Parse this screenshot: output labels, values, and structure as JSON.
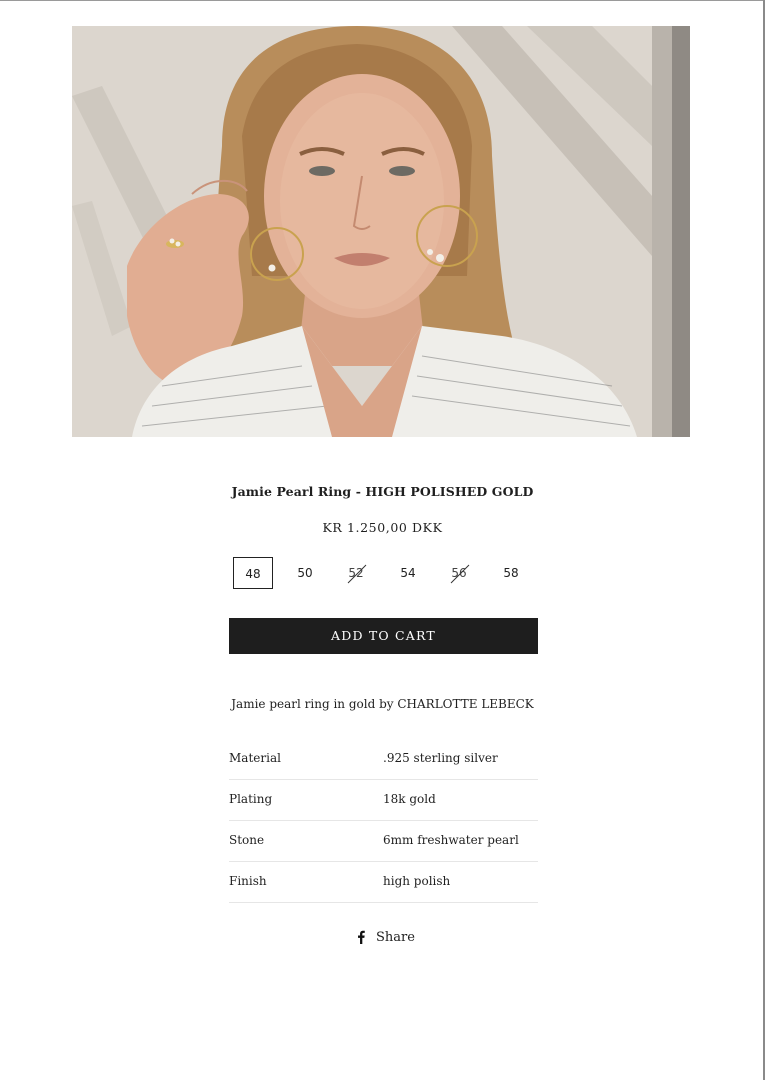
{
  "product": {
    "image_alt": "Model wearing Jamie pearl ring and pearl hoop earrings",
    "title": "Jamie Pearl Ring - HIGH POLISHED GOLD",
    "price": "KR 1.250,00 DKK",
    "sizes": [
      {
        "label": "48",
        "state": "selected"
      },
      {
        "label": "50",
        "state": "available"
      },
      {
        "label": "52",
        "state": "sold-out"
      },
      {
        "label": "54",
        "state": "available"
      },
      {
        "label": "56",
        "state": "sold-out"
      },
      {
        "label": "58",
        "state": "available"
      }
    ],
    "add_to_cart_label": "ADD TO CART",
    "description": "Jamie pearl ring in gold by CHARLOTTE LEBECK",
    "specs": [
      {
        "key": "Material",
        "value": ".925 sterling silver"
      },
      {
        "key": "Plating",
        "value": "18k gold"
      },
      {
        "key": "Stone",
        "value": "6mm freshwater pearl"
      },
      {
        "key": "Finish",
        "value": "high polish"
      }
    ],
    "share": {
      "label": "Share",
      "icon": "facebook-icon"
    }
  },
  "colors": {
    "button_bg": "#1e1e1e",
    "button_text": "#ffffff",
    "divider": "#e6e6e6",
    "text": "#1f1f1f"
  }
}
